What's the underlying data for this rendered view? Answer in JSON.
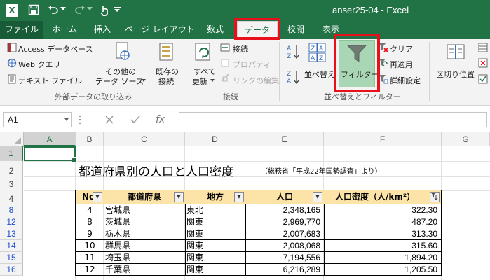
{
  "app": {
    "window_title": "anser25-04 - Excel",
    "logo_letter": "X"
  },
  "tabs": [
    {
      "label": "ファイル"
    },
    {
      "label": "ホーム"
    },
    {
      "label": "挿入"
    },
    {
      "label": "ページ レイアウト"
    },
    {
      "label": "数式"
    },
    {
      "label": "データ"
    },
    {
      "label": "校閲"
    },
    {
      "label": "表示"
    }
  ],
  "ribbon": {
    "external": {
      "access": "Access データベース",
      "web": "Web クエリ",
      "text": "テキスト ファイル",
      "other_line1": "その他の",
      "other_line2": "データ ソース",
      "existing_line1": "既存の",
      "existing_line2": "接続",
      "group_label": "外部データの取り込み"
    },
    "connections": {
      "refresh_line1": "すべて",
      "refresh_line2": "更新",
      "connections": "接続",
      "properties": "プロパティ",
      "edit_links": "リンクの編集",
      "group_label": "接続"
    },
    "sort_filter": {
      "sort": "並べ替え",
      "filter": "フィルター",
      "clear": "クリア",
      "reapply": "再適用",
      "advanced": "詳細設定",
      "group_label": "並べ替えとフィルター"
    },
    "tools": {
      "text_to_columns": "区切り位置"
    }
  },
  "formula_bar": {
    "name_box": "A1",
    "fx": "fx",
    "value": ""
  },
  "columns": [
    "A",
    "B",
    "C",
    "D",
    "E",
    "F",
    "G"
  ],
  "rows": [
    "1",
    "2",
    "3",
    "4",
    "8",
    "12",
    "13",
    "14",
    "15",
    "16"
  ],
  "sheet": {
    "title": "都道府県別の人口と人口密度",
    "subtitle": "（総務省「平成22年国勢調査」より）",
    "headers": [
      "No",
      "都道府県",
      "地方",
      "人口",
      "人口密度（人/km²）"
    ],
    "data": [
      {
        "no": "4",
        "pref": "宮城県",
        "region": "東北",
        "pop": "2,348,165",
        "density": "322.30"
      },
      {
        "no": "8",
        "pref": "茨城県",
        "region": "関東",
        "pop": "2,969,770",
        "density": "487.20"
      },
      {
        "no": "9",
        "pref": "栃木県",
        "region": "関東",
        "pop": "2,007,683",
        "density": "313.30"
      },
      {
        "no": "10",
        "pref": "群馬県",
        "region": "関東",
        "pop": "2,008,068",
        "density": "315.60"
      },
      {
        "no": "11",
        "pref": "埼玉県",
        "region": "関東",
        "pop": "7,194,556",
        "density": "1,894.20"
      },
      {
        "no": "12",
        "pref": "千葉県",
        "region": "関東",
        "pop": "6,216,289",
        "density": "1,205.50"
      }
    ]
  },
  "colors": {
    "excel_green": "#217346",
    "highlight_red": "#e8101b",
    "filter_active": "#a9d6b4",
    "table_header_fill": "#fce4a8",
    "filtered_row_number": "#1f4fd2"
  }
}
